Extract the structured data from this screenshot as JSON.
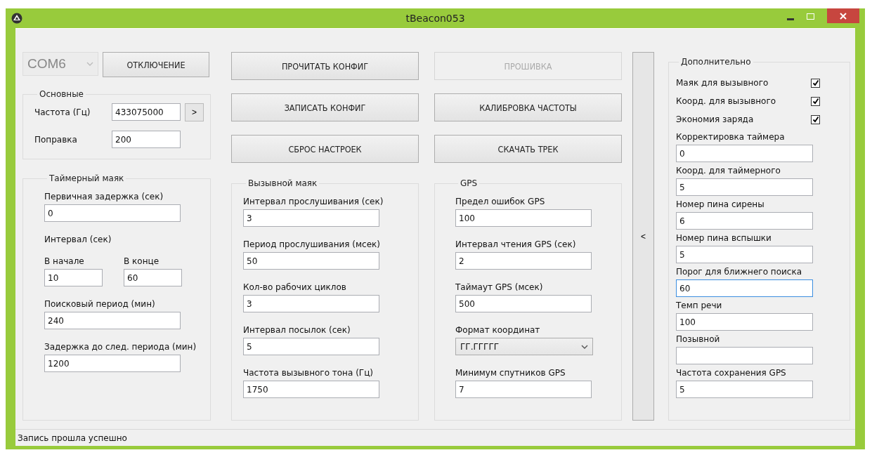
{
  "window": {
    "title": "tBeacon053"
  },
  "port": {
    "value": "COM6",
    "disabled": true
  },
  "columns": [
    {
      "buttons": [
        {
          "label": "ОТКЛЮЧЕНИЕ",
          "disabled": false
        }
      ]
    },
    {
      "buttons": [
        {
          "label": "ПРОЧИТАТЬ КОНФИГ",
          "disabled": false
        },
        {
          "label": "ЗАПИСАТЬ КОНФИГ",
          "disabled": false
        },
        {
          "label": "СБРОС НАСТРОЕК",
          "disabled": false
        }
      ]
    },
    {
      "buttons": [
        {
          "label": "ПРОШИВКА",
          "disabled": true
        },
        {
          "label": "КАЛИБРОВКА ЧАСТОТЫ",
          "disabled": false
        },
        {
          "label": "СКАЧАТЬ ТРЕК",
          "disabled": false
        }
      ]
    }
  ],
  "main_group": {
    "title": "Основные",
    "fields": [
      {
        "label": "Частота (Гц)",
        "value": "433075000",
        "button": ">"
      },
      {
        "label": "Поправка",
        "value": "200"
      }
    ]
  },
  "groups": [
    {
      "title": "Таймерный маяк",
      "items": [
        {
          "kind": "field",
          "label": "Первичная задержка (сек)",
          "value": "0"
        },
        {
          "kind": "heading",
          "label": "Интервал (сек)"
        },
        {
          "kind": "pair",
          "fields": [
            {
              "label": "В начале",
              "value": "10"
            },
            {
              "label": "В конце",
              "value": "60"
            }
          ]
        },
        {
          "kind": "field",
          "label": "Поисковый период (мин)",
          "value": "240"
        },
        {
          "kind": "field",
          "label": "Задержка до след. периода (мин)",
          "value": "1200"
        }
      ]
    },
    {
      "title": "Вызывной маяк",
      "items": [
        {
          "kind": "field",
          "label": "Интервал прослушивания (сек)",
          "value": "3"
        },
        {
          "kind": "field",
          "label": "Период прослушивания (мсек)",
          "value": "50"
        },
        {
          "kind": "field",
          "label": "Кол-во рабочих циклов",
          "value": "3"
        },
        {
          "kind": "field",
          "label": "Интервал посылок (сек)",
          "value": "5"
        },
        {
          "kind": "field",
          "label": "Частота вызывного тона (Гц)",
          "value": "1750"
        }
      ]
    },
    {
      "title": "GPS",
      "items": [
        {
          "kind": "field",
          "label": "Предел ошибок GPS",
          "value": "100"
        },
        {
          "kind": "field",
          "label": "Интервал чтения GPS (сек)",
          "value": "2"
        },
        {
          "kind": "field",
          "label": "Таймаут GPS (мсек)",
          "value": "500"
        },
        {
          "kind": "select",
          "label": "Формат координат",
          "value": "ГГ.ГГГГГ"
        },
        {
          "kind": "field",
          "label": "Минимум спутников GPS",
          "value": "7"
        }
      ]
    }
  ],
  "collapse_button": "<",
  "extra": {
    "title": "Дополнительно",
    "items": [
      {
        "kind": "checkbox",
        "label": "Маяк для вызывного",
        "checked": true
      },
      {
        "kind": "checkbox",
        "label": "Коорд. для вызывного",
        "checked": true
      },
      {
        "kind": "checkbox",
        "label": "Экономия заряда",
        "checked": true
      },
      {
        "kind": "field",
        "label": "Корректировка таймера",
        "value": "0",
        "focused": false
      },
      {
        "kind": "field",
        "label": "Коорд. для таймерного",
        "value": "5",
        "focused": false
      },
      {
        "kind": "field",
        "label": "Номер пина сирены",
        "value": "6",
        "focused": false
      },
      {
        "kind": "field",
        "label": "Номер пина вспышки",
        "value": "5",
        "focused": false
      },
      {
        "kind": "field",
        "label": "Порог для ближнего поиска",
        "value": "60",
        "focused": true
      },
      {
        "kind": "field",
        "label": "Темп речи",
        "value": "100",
        "focused": false
      },
      {
        "kind": "field",
        "label": "Позывной",
        "focused": false
      },
      {
        "kind": "field",
        "label": "Частота сохранения GPS",
        "value": "5",
        "focused": false
      }
    ]
  },
  "status_bar": "Запись прошла успешно"
}
